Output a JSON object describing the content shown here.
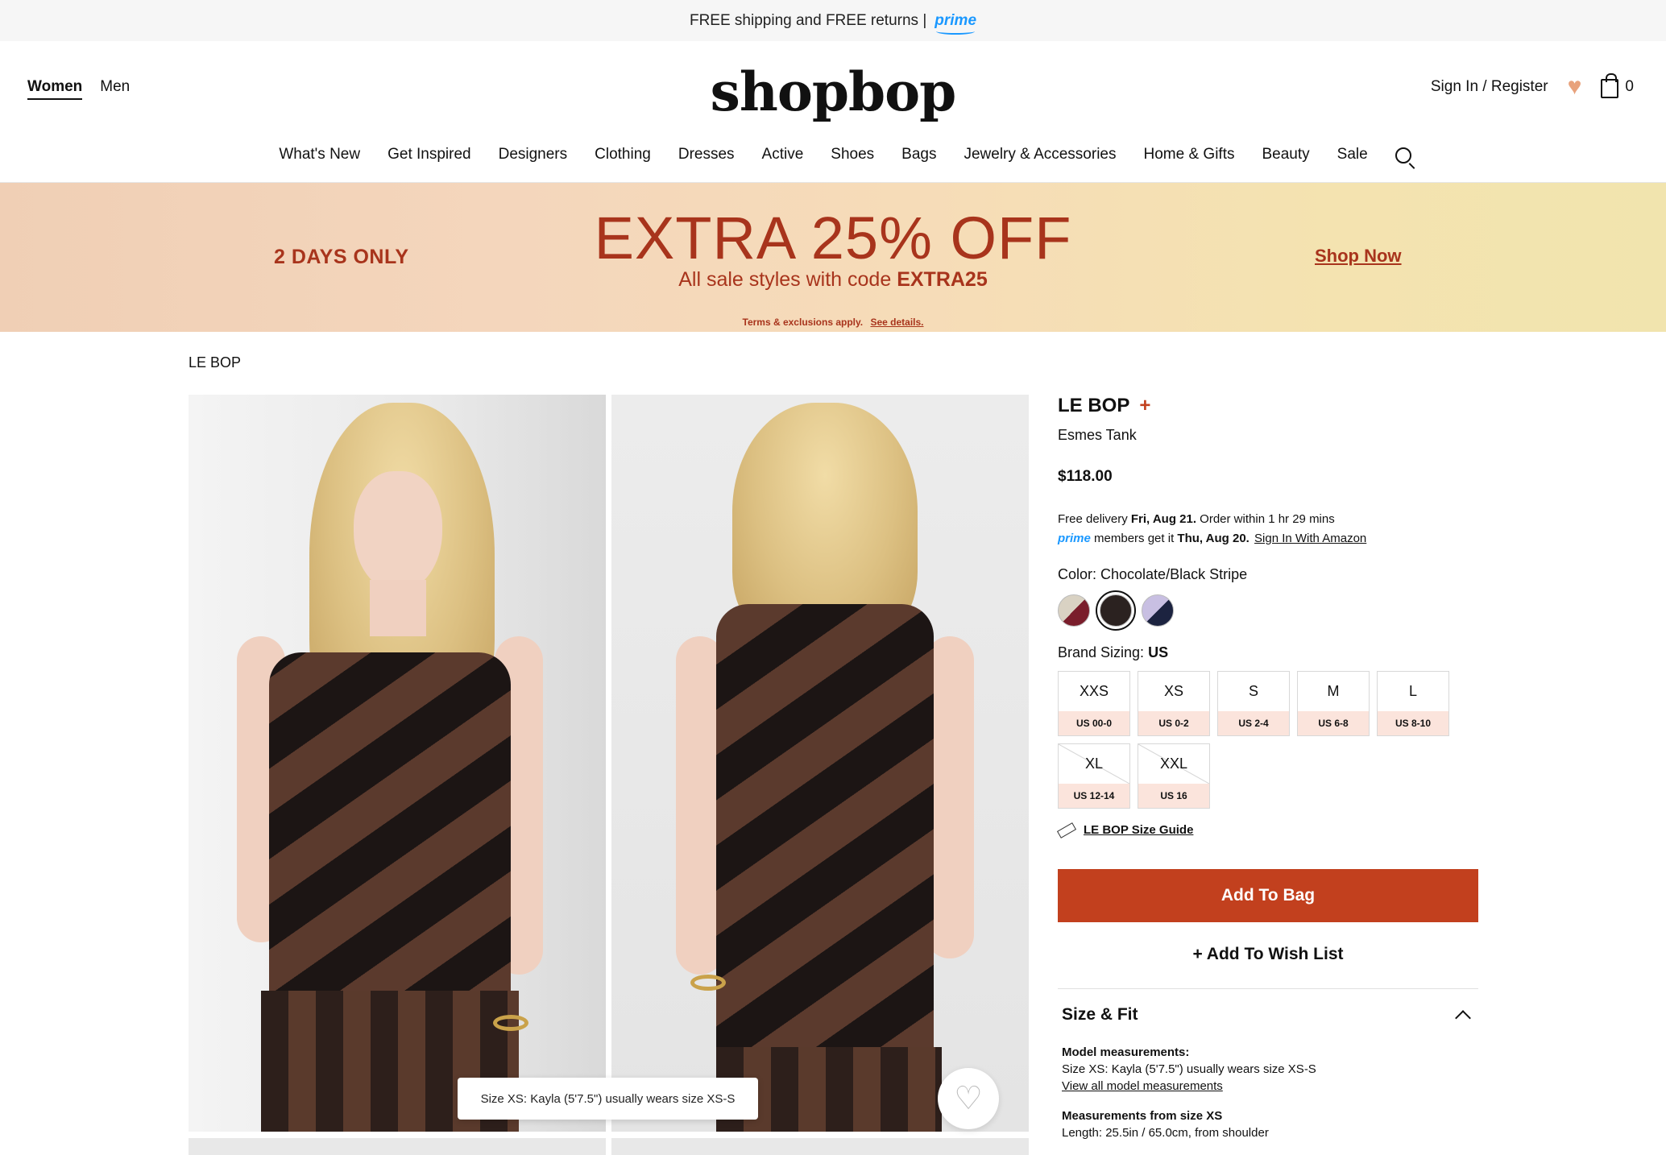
{
  "topbar": {
    "text": "FREE shipping and FREE returns |",
    "prime_logo": "prime"
  },
  "header": {
    "gender_tabs": [
      "Women",
      "Men"
    ],
    "logo": "shopbop",
    "sign_in": "Sign In / Register",
    "bag_count": "0",
    "nav": [
      "What's New",
      "Get Inspired",
      "Designers",
      "Clothing",
      "Dresses",
      "Active",
      "Shoes",
      "Bags",
      "Jewelry & Accessories",
      "Home & Gifts",
      "Beauty",
      "Sale"
    ]
  },
  "promo": {
    "days": "2 DAYS ONLY",
    "headline": "EXTRA 25% OFF",
    "sub_text": "All sale styles with code",
    "code": "EXTRA25",
    "shop_now": "Shop Now",
    "terms": "Terms & exclusions apply.",
    "see_details": "See details."
  },
  "breadcrumb": "LE BOP",
  "gallery": {
    "tooltip": "Size XS: Kayla (5'7.5\") usually wears size XS-S"
  },
  "product": {
    "brand": "LE BOP",
    "brand_plus": "+",
    "name": "Esmes Tank",
    "price": "$118.00",
    "delivery": {
      "free_delivery": "Free delivery",
      "date": "Fri, Aug 21.",
      "order_within": "Order within 1 hr 29 mins",
      "prime_logo": "prime",
      "members": "members get it",
      "prime_date": "Thu, Aug 20.",
      "sign_in_amazon": "Sign In With Amazon"
    },
    "color_label": "Color: Chocolate/Black Stripe",
    "swatch_colors": [
      "#7a1d2b",
      "#2b2220",
      "#1c2340"
    ],
    "brand_sizing_label": "Brand Sizing:",
    "brand_sizing_value": "US",
    "sizes": [
      {
        "label": "XXS",
        "us": "US 00-0"
      },
      {
        "label": "XS",
        "us": "US 0-2"
      },
      {
        "label": "S",
        "us": "US 2-4"
      },
      {
        "label": "M",
        "us": "US 6-8"
      },
      {
        "label": "L",
        "us": "US 8-10"
      },
      {
        "label": "XL",
        "us": "US 12-14"
      },
      {
        "label": "XXL",
        "us": "US 16"
      }
    ],
    "size_guide": "LE BOP Size Guide",
    "add_to_bag": "Add To Bag",
    "add_to_wish": "+ Add To Wish List",
    "size_fit": {
      "title": "Size & Fit",
      "model_heading": "Model measurements:",
      "model_text": "Size XS: Kayla (5'7.5\") usually wears size XS-S",
      "view_all": "View all model measurements",
      "measure_heading": "Measurements from size XS",
      "length": "Length: 25.5in / 65.0cm, from shoulder"
    }
  },
  "colors": {
    "accent": "#c2401e",
    "prime": "#1a98ff",
    "promo_text": "#a8341c"
  }
}
